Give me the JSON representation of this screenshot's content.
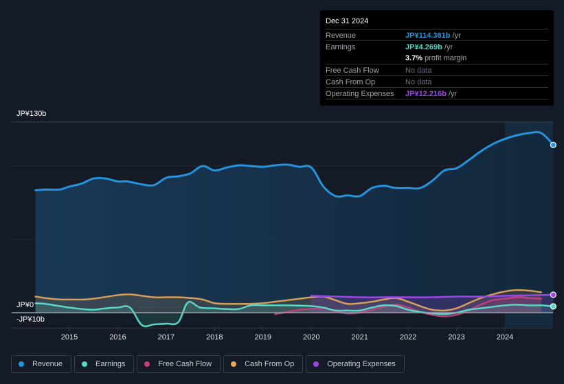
{
  "tooltip": {
    "date": "Dec 31 2024",
    "rows": [
      {
        "label": "Revenue",
        "value": "JP¥114.361b",
        "unit": " /yr",
        "color": "#2394df"
      },
      {
        "label": "Earnings",
        "value": "JP¥4.269b",
        "unit": " /yr",
        "color": "#58d7c5"
      },
      {
        "label": "",
        "value": "3.7%",
        "unit": " profit margin",
        "color": "#ffffff"
      },
      {
        "label": "Free Cash Flow",
        "value": "No data",
        "unit": "",
        "color": "#6b7078"
      },
      {
        "label": "Cash From Op",
        "value": "No data",
        "unit": "",
        "color": "#6b7078"
      },
      {
        "label": "Operating Expenses",
        "value": "JP¥12.216b",
        "unit": " /yr",
        "color": "#9b47e5"
      }
    ]
  },
  "legend": [
    {
      "label": "Revenue",
      "color": "#2394df"
    },
    {
      "label": "Earnings",
      "color": "#58d7c5"
    },
    {
      "label": "Free Cash Flow",
      "color": "#c5427f"
    },
    {
      "label": "Cash From Op",
      "color": "#e8a85a"
    },
    {
      "label": "Operating Expenses",
      "color": "#9b47e5"
    }
  ],
  "chart_data": {
    "type": "line",
    "title": "",
    "xlabel": "",
    "ylabel": "",
    "y_top_label": "JP¥130b",
    "y_zero_label": "JP¥0",
    "y_neg_label": "-JP¥10b",
    "ylim": [
      -10,
      130
    ],
    "xlim": [
      2014.3,
      2025.0
    ],
    "x_ticks": [
      "2015",
      "2016",
      "2017",
      "2018",
      "2019",
      "2020",
      "2021",
      "2022",
      "2023",
      "2024"
    ],
    "x_tick_values": [
      2015,
      2016,
      2017,
      2018,
      2019,
      2020,
      2021,
      2022,
      2023,
      2024
    ],
    "highlight_start": 2024.0,
    "series": [
      {
        "name": "Revenue",
        "color": "#2394df",
        "x": [
          2014.3,
          2014.5,
          2014.8,
          2015.0,
          2015.25,
          2015.5,
          2015.75,
          2016.0,
          2016.2,
          2016.5,
          2016.75,
          2017.0,
          2017.25,
          2017.5,
          2017.75,
          2018.0,
          2018.25,
          2018.5,
          2018.75,
          2019.0,
          2019.25,
          2019.5,
          2019.75,
          2020.0,
          2020.25,
          2020.5,
          2020.75,
          2021.0,
          2021.25,
          2021.5,
          2021.75,
          2022.0,
          2022.25,
          2022.5,
          2022.75,
          2023.0,
          2023.25,
          2023.5,
          2023.75,
          2024.0,
          2024.25,
          2024.5,
          2024.75,
          2025.0
        ],
        "values": [
          83.5,
          84.0,
          84.0,
          86.0,
          88.0,
          91.5,
          91.5,
          89.5,
          89.5,
          87.5,
          87.0,
          92.0,
          93.0,
          95.0,
          100.0,
          97.0,
          99.0,
          100.5,
          100.0,
          99.5,
          100.5,
          101.0,
          99.5,
          99.0,
          86.0,
          79.5,
          80.0,
          79.5,
          85.0,
          86.5,
          85.0,
          85.0,
          85.0,
          90.0,
          97.0,
          98.5,
          104.0,
          110.0,
          115.0,
          118.5,
          121.0,
          122.5,
          122.5,
          114.4
        ]
      },
      {
        "name": "Earnings",
        "color": "#58d7c5",
        "x": [
          2014.3,
          2014.5,
          2014.8,
          2015.0,
          2015.25,
          2015.5,
          2015.75,
          2016.0,
          2016.25,
          2016.5,
          2016.75,
          2017.0,
          2017.25,
          2017.45,
          2017.7,
          2018.0,
          2018.25,
          2018.5,
          2018.75,
          2019.0,
          2019.5,
          2020.0,
          2020.25,
          2020.5,
          2020.75,
          2021.0,
          2021.25,
          2021.5,
          2021.75,
          2022.0,
          2022.25,
          2022.5,
          2022.75,
          2023.0,
          2023.25,
          2023.5,
          2023.75,
          2024.0,
          2024.25,
          2024.5,
          2024.75,
          2025.0
        ],
        "values": [
          6.5,
          6.0,
          4.5,
          3.5,
          2.5,
          2.0,
          3.0,
          3.5,
          3.5,
          -8.5,
          -8.0,
          -7.5,
          -6.5,
          7.0,
          3.5,
          3.0,
          2.5,
          2.5,
          5.0,
          5.0,
          5.0,
          4.5,
          3.5,
          1.5,
          1.5,
          1.5,
          3.5,
          5.0,
          4.5,
          2.0,
          0.5,
          -0.5,
          -1.0,
          0.0,
          2.0,
          3.0,
          4.0,
          5.0,
          5.5,
          5.0,
          5.0,
          4.3
        ]
      },
      {
        "name": "Free Cash Flow",
        "color": "#c5427f",
        "x": [
          2019.25,
          2019.5,
          2019.75,
          2020.0,
          2020.25,
          2020.5,
          2020.75,
          2021.0,
          2021.25,
          2021.5,
          2021.75,
          2022.0,
          2022.25,
          2022.5,
          2022.75,
          2023.0,
          2023.25,
          2023.5,
          2023.75,
          2024.0,
          2024.25,
          2024.5,
          2024.75
        ],
        "values": [
          -1.0,
          0.5,
          2.0,
          2.5,
          3.0,
          1.0,
          -0.5,
          0.0,
          2.0,
          4.0,
          5.5,
          3.5,
          0.5,
          -1.5,
          -2.5,
          -1.5,
          1.5,
          5.5,
          8.5,
          9.5,
          10.5,
          10.0,
          9.5
        ]
      },
      {
        "name": "Cash From Op",
        "color": "#e8a85a",
        "x": [
          2014.3,
          2014.5,
          2014.8,
          2015.0,
          2015.3,
          2015.6,
          2016.0,
          2016.25,
          2016.5,
          2016.75,
          2017.0,
          2017.25,
          2017.5,
          2017.75,
          2018.0,
          2018.25,
          2018.5,
          2018.75,
          2019.0,
          2019.25,
          2019.5,
          2019.75,
          2020.0,
          2020.25,
          2020.5,
          2020.75,
          2021.0,
          2021.25,
          2021.5,
          2021.75,
          2022.0,
          2022.25,
          2022.5,
          2022.75,
          2023.0,
          2023.25,
          2023.5,
          2023.75,
          2024.0,
          2024.25,
          2024.5,
          2024.75
        ],
        "values": [
          11.0,
          10.0,
          9.0,
          9.0,
          9.0,
          10.0,
          12.0,
          12.5,
          11.5,
          10.5,
          10.5,
          10.5,
          10.0,
          9.0,
          6.5,
          6.0,
          6.0,
          6.0,
          6.5,
          7.5,
          8.5,
          9.5,
          10.5,
          11.0,
          8.5,
          6.0,
          6.5,
          7.5,
          9.0,
          10.0,
          7.5,
          4.5,
          2.0,
          1.5,
          3.0,
          6.5,
          10.0,
          12.5,
          14.5,
          15.5,
          15.0,
          14.0
        ]
      },
      {
        "name": "Operating Expenses",
        "color": "#9b47e5",
        "x": [
          2020.0,
          2020.5,
          2021.0,
          2021.5,
          2022.0,
          2022.5,
          2023.0,
          2023.5,
          2024.0,
          2024.5,
          2025.0
        ],
        "values": [
          11.5,
          11.0,
          10.5,
          10.5,
          10.5,
          10.5,
          11.0,
          11.0,
          11.5,
          11.8,
          12.2
        ]
      }
    ]
  }
}
